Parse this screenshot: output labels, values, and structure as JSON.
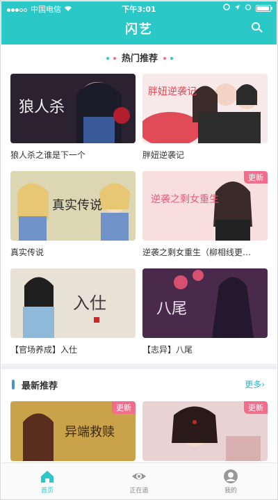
{
  "status": {
    "carrier": "中国电信",
    "time": "下午3:01"
  },
  "nav": {
    "title": "闪艺",
    "search_icon": "search-icon"
  },
  "hot": {
    "title": "热门推荐",
    "items": [
      {
        "label": "狼人杀之谁是下一个",
        "cover_text": "狼人杀",
        "badge": ""
      },
      {
        "label": "胖妞逆袭记",
        "cover_text": "胖妞逆袭记",
        "badge": ""
      },
      {
        "label": "真实传说",
        "cover_text": "真实传说",
        "badge": ""
      },
      {
        "label": "逆袭之剩女重生（柳相线更…",
        "cover_text": "逆袭之剩女重生",
        "badge": "更新"
      },
      {
        "label": "【官场养成】入仕",
        "cover_text": "入仕",
        "badge": ""
      },
      {
        "label": "【志异】八尾",
        "cover_text": "八尾",
        "badge": ""
      }
    ]
  },
  "latest": {
    "title": "最新推荐",
    "more": "更多›",
    "items": [
      {
        "cover_text": "异端救赎",
        "badge": "更新"
      },
      {
        "cover_text": "",
        "badge": "更新"
      }
    ]
  },
  "tabs": [
    {
      "label": "首页",
      "icon": "home-icon",
      "active": true
    },
    {
      "label": "正在追",
      "icon": "eye-icon",
      "active": false
    },
    {
      "label": "我的",
      "icon": "profile-icon",
      "active": false
    }
  ],
  "colors": {
    "accent": "#2bc8c8",
    "badge": "#f26c8b",
    "link": "#2bb6c8"
  }
}
